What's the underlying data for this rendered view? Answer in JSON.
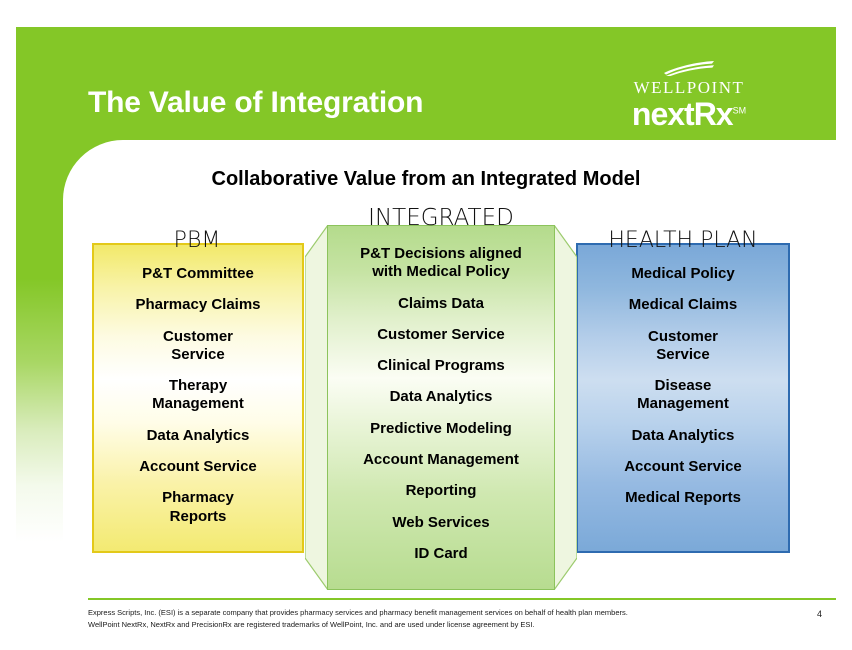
{
  "header": {
    "title": "The Value of Integration",
    "logo": {
      "brand": "WELLPOINT",
      "product": "nextRx",
      "trademark": "SM",
      "swoosh_icon": "swoosh-icon"
    },
    "background_color": "#84c727"
  },
  "subtitle": "Collaborative Value from an Integrated Model",
  "diagram": {
    "columns": [
      {
        "id": "pbm",
        "header": "PBM",
        "fill_color": "#f3ea72",
        "border_color": "#e3c919",
        "items": [
          "P&T Committee",
          "Pharmacy Claims",
          "Customer\nService",
          "Therapy\nManagement",
          "Data Analytics",
          "Account Service",
          "Pharmacy\nReports"
        ]
      },
      {
        "id": "integrated",
        "header": "INTEGRATED",
        "fill_color": "#b7dc90",
        "border_color": "#8cc35c",
        "items": [
          "P&T Decisions aligned\nwith Medical Policy",
          "Claims Data",
          "Customer Service",
          "Clinical Programs",
          "Data Analytics",
          "Predictive Modeling",
          "Account Management",
          "Reporting",
          "Web Services",
          "ID Card"
        ]
      },
      {
        "id": "health-plan",
        "header": "HEALTH PLAN",
        "fill_color": "#7ba9d8",
        "border_color": "#2e6bb0",
        "items": [
          "Medical Policy",
          "Medical Claims",
          "Customer\nService",
          "Disease\nManagement",
          "Data Analytics",
          "Account Service",
          "Medical Reports"
        ]
      }
    ]
  },
  "footer": {
    "line1": "Express Scripts, Inc. (ESI) is a separate company that provides pharmacy services and pharmacy benefit management services on behalf of health plan members.",
    "line2": "WellPoint NextRx, NextRx and PrecisionRx are registered trademarks of WellPoint, Inc. and are used under license agreement by ESI.",
    "page_number": "4",
    "rule_color": "#84c727"
  }
}
